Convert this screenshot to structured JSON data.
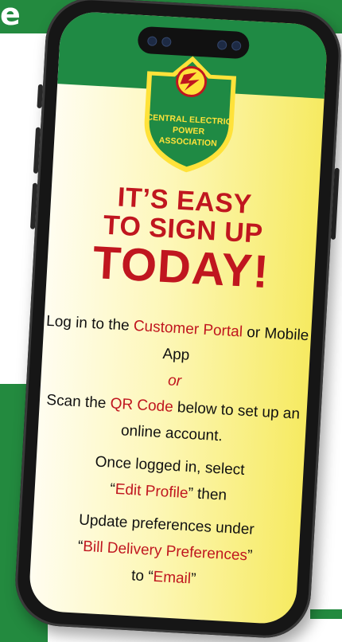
{
  "background": {
    "top_band_color": "#238a3f",
    "partial_text": "e"
  },
  "logo": {
    "line1": "CENTRAL ELECTRIC",
    "line2": "POWER",
    "line3": "ASSOCIATION"
  },
  "headline": {
    "line1": "IT’S EASY",
    "line2": "TO SIGN UP",
    "line3": "TODAY!"
  },
  "instructions": {
    "p1_before": "Log in to the ",
    "p1_link": "Customer Portal",
    "p1_after": " or Mobile App",
    "or": "or",
    "p2_before": "Scan the ",
    "p2_link": "QR Code",
    "p2_after": " below to set up an online account.",
    "p3_before": "Once logged in, select",
    "p3_quote_open": "“",
    "p3_link": "Edit Profile",
    "p3_quote_close": "”",
    "p3_after": " then",
    "p4_before": "Update preferences under",
    "p4_quote_open": "“",
    "p4_link": "Bill Delivery Preferences",
    "p4_quote_close": "”",
    "p4_mid": "to ",
    "p4_quote2_open": "“",
    "p4_link2": "Email",
    "p4_quote2_close": "”"
  },
  "colors": {
    "accent_red": "#c0161f",
    "brand_green": "#1f8a44",
    "logo_yellow": "#ffe23a"
  }
}
